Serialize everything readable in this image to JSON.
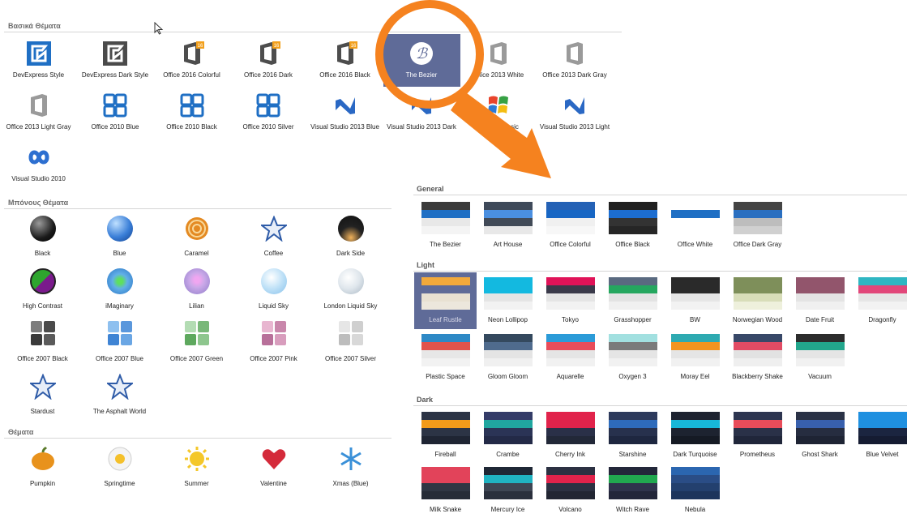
{
  "sections": {
    "basic": "Βασικά Θέματα",
    "bonus": "Μπόνους Θέματα",
    "themes": "Θέματα"
  },
  "basic_skins": [
    {
      "label": "DevExpress Style",
      "icon": "devexpress-icon"
    },
    {
      "label": "DevExpress Dark Style",
      "icon": "devexpress-dark-icon"
    },
    {
      "label": "Office 2016 Colorful",
      "icon": "office-2016-icon"
    },
    {
      "label": "Office 2016 Dark",
      "icon": "office-2016-icon"
    },
    {
      "label": "Office 2016 Black",
      "icon": "office-2016-icon"
    },
    {
      "label": "The Bezier",
      "icon": "bezier-icon",
      "selected": true
    },
    {
      "label": "Office 2013 White",
      "icon": "office-2013-icon"
    },
    {
      "label": "Office 2013 Dark Gray",
      "icon": "office-2013-icon"
    },
    {
      "label": "Office 2013 Light Gray",
      "icon": "office-2013-icon"
    },
    {
      "label": "Office 2010 Blue",
      "icon": "office-2010-icon"
    },
    {
      "label": "Office 2010 Black",
      "icon": "office-2010-icon"
    },
    {
      "label": "Office 2010 Silver",
      "icon": "office-2010-icon"
    },
    {
      "label": "Visual Studio 2013 Blue",
      "icon": "visual-studio-icon"
    },
    {
      "label": "Visual Studio 2013 Dark",
      "icon": "visual-studio-icon"
    },
    {
      "label": "Seven Classic",
      "icon": "windows-flag-icon"
    },
    {
      "label": "Visual Studio 2013 Light",
      "icon": "visual-studio-icon"
    },
    {
      "label": "Visual Studio 2010",
      "icon": "infinity-icon"
    }
  ],
  "bonus_skins": [
    {
      "label": "Black",
      "icon": "black-ball-icon"
    },
    {
      "label": "Blue",
      "icon": "blue-ball-icon"
    },
    {
      "label": "Caramel",
      "icon": "caramel-icon"
    },
    {
      "label": "Coffee",
      "icon": "star-icon"
    },
    {
      "label": "Dark Side",
      "icon": "dark-side-ball-icon"
    },
    {
      "label": "High Contrast",
      "icon": "high-contrast-icon"
    },
    {
      "label": "iMaginary",
      "icon": "imaginary-ball-icon"
    },
    {
      "label": "Lilian",
      "icon": "lilian-ball-icon"
    },
    {
      "label": "Liquid Sky",
      "icon": "liquid-sky-ball-icon"
    },
    {
      "label": "London Liquid Sky",
      "icon": "london-ball-icon"
    },
    {
      "label": "Office 2007 Black",
      "icon": "office-2007-icon"
    },
    {
      "label": "Office 2007 Blue",
      "icon": "office-2007-icon"
    },
    {
      "label": "Office 2007 Green",
      "icon": "office-2007-icon"
    },
    {
      "label": "Office 2007 Pink",
      "icon": "office-2007-icon"
    },
    {
      "label": "Office 2007 Silver",
      "icon": "office-2007-icon"
    },
    {
      "label": "Stardust",
      "icon": "star-icon"
    },
    {
      "label": "The Asphalt World",
      "icon": "star-icon"
    }
  ],
  "holiday_skins": [
    {
      "label": "Pumpkin",
      "icon": "pumpkin-icon"
    },
    {
      "label": "Springtime",
      "icon": "flower-icon"
    },
    {
      "label": "Summer",
      "icon": "sun-icon"
    },
    {
      "label": "Valentine",
      "icon": "heart-icon"
    },
    {
      "label": "Xmas (Blue)",
      "icon": "snowflake-icon"
    }
  ],
  "palette_sections": {
    "general": "General",
    "light": "Light",
    "dark": "Dark"
  },
  "general_palettes": [
    {
      "label": "The Bezier",
      "colors": [
        "#3b3b3b",
        "#1f6fc4",
        "#e8e8e8",
        "#f4f4f4"
      ]
    },
    {
      "label": "Art House",
      "colors": [
        "#3f4a5a",
        "#4a8fe0",
        "#414a57",
        "#e8e8e8"
      ]
    },
    {
      "label": "Office Colorful",
      "colors": [
        "#2461b5",
        "#1766c4",
        "#f0f0f0",
        "#f7f7f7"
      ]
    },
    {
      "label": "Office Black",
      "colors": [
        "#202020",
        "#1c6dd0",
        "#333333",
        "#262626"
      ]
    },
    {
      "label": "Office White",
      "colors": [
        "#ffffff",
        "#1f6fc4",
        "#ffffff",
        "#ffffff"
      ]
    },
    {
      "label": "Office Dark Gray",
      "colors": [
        "#444444",
        "#2a6fc0",
        "#bdbdbd",
        "#d0d0d0"
      ]
    }
  ],
  "light_palettes": [
    {
      "label": "Leaf Rustle",
      "colors": [
        "#f2a93b",
        "#5f6b98",
        "#e8e1d2",
        "#ece7dc"
      ],
      "selected": true
    },
    {
      "label": "Neon Lollipop",
      "colors": [
        "#13b9e0",
        "#13b9e0",
        "#e5e5e5",
        "#f2f2f2"
      ]
    },
    {
      "label": "Tokyo",
      "colors": [
        "#e01358",
        "#3a3a4a",
        "#e5e5e5",
        "#f2f2f2"
      ]
    },
    {
      "label": "Grasshopper",
      "colors": [
        "#5a6a80",
        "#25a75f",
        "#e3e3e3",
        "#f0f0f0"
      ]
    },
    {
      "label": "BW",
      "colors": [
        "#2a2a2a",
        "#2a2a2a",
        "#e6e6e6",
        "#f2f2f2"
      ]
    },
    {
      "label": "Norwegian Wood",
      "colors": [
        "#7e8f5a",
        "#7e8f5a",
        "#d8ddb9",
        "#eef0dc"
      ]
    },
    {
      "label": "Date Fruit",
      "colors": [
        "#92556c",
        "#92556c",
        "#e4e4e4",
        "#f0f0f0"
      ]
    },
    {
      "label": "Dragonfly",
      "colors": [
        "#2fb6c2",
        "#e2477a",
        "#e6e6e6",
        "#f2f2f2"
      ]
    },
    {
      "label": "Plastic Space",
      "colors": [
        "#2e89c6",
        "#e2534c",
        "#e7e7e7",
        "#f2f2f2"
      ]
    },
    {
      "label": "Gloom Gloom",
      "colors": [
        "#34495e",
        "#4f6b8d",
        "#e4e4e4",
        "#f0f0f0"
      ]
    },
    {
      "label": "Aquarelle",
      "colors": [
        "#2b9bd8",
        "#e84c5a",
        "#e5e5e5",
        "#f1f1f1"
      ]
    },
    {
      "label": "Oxygen 3",
      "colors": [
        "#a2e0e0",
        "#7a7a7a",
        "#e5e5e5",
        "#f1f1f1"
      ]
    },
    {
      "label": "Moray Eel",
      "colors": [
        "#2eaab1",
        "#f2941f",
        "#e5e5e5",
        "#f1f1f1"
      ]
    },
    {
      "label": "Blackberry Shake",
      "colors": [
        "#384868",
        "#e14b64",
        "#e2e2e2",
        "#efefef"
      ]
    },
    {
      "label": "Vacuum",
      "colors": [
        "#2c2c2c",
        "#22a68c",
        "#e5e5e5",
        "#f1f1f1"
      ]
    }
  ],
  "dark_palettes": [
    {
      "label": "Fireball",
      "colors": [
        "#2c3445",
        "#f29b1a",
        "#2c3445",
        "#1f2533"
      ]
    },
    {
      "label": "Crambe",
      "colors": [
        "#343c68",
        "#20a6a0",
        "#2b3456",
        "#232a47"
      ]
    },
    {
      "label": "Cherry Ink",
      "colors": [
        "#e1234b",
        "#e1234b",
        "#2a3048",
        "#222838"
      ]
    },
    {
      "label": "Starshine",
      "colors": [
        "#2d3a5c",
        "#2e6bbb",
        "#27314d",
        "#1e2740"
      ]
    },
    {
      "label": "Dark Turquoise",
      "colors": [
        "#1d2330",
        "#17b7d8",
        "#1d2330",
        "#151a24"
      ]
    },
    {
      "label": "Prometheus",
      "colors": [
        "#2d3550",
        "#e84c5a",
        "#2a3148",
        "#20263a"
      ]
    },
    {
      "label": "Ghost Shark",
      "colors": [
        "#2a3246",
        "#3860ad",
        "#262d40",
        "#1e2434"
      ]
    },
    {
      "label": "Blue Velvet",
      "colors": [
        "#1f90e0",
        "#1f90e0",
        "#1b2540",
        "#151c32"
      ]
    },
    {
      "label": "Milk Snake",
      "colors": [
        "#e2435a",
        "#e2435a",
        "#2f3643",
        "#262c37"
      ]
    },
    {
      "label": "Mercury Ice",
      "colors": [
        "#1f2735",
        "#20b3c2",
        "#3e4654",
        "#2a303d"
      ]
    },
    {
      "label": "Volcano",
      "colors": [
        "#2c3142",
        "#e1234b",
        "#2c3142",
        "#222633"
      ]
    },
    {
      "label": "Witch Rave",
      "colors": [
        "#23273a",
        "#21a84f",
        "#2f334c",
        "#23263a"
      ]
    },
    {
      "label": "Nebula",
      "colors": [
        "#2b66b0",
        "#2a4d86",
        "#23406e",
        "#1d355c"
      ]
    }
  ],
  "accent": "#f5821f"
}
